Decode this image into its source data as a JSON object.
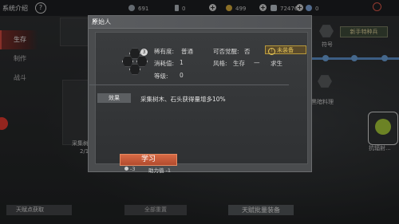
{
  "topbar": {
    "title": "系统介绍",
    "help": "?",
    "resources": [
      {
        "name": "resource-a",
        "value": "691",
        "color": "#9aa3ac"
      },
      {
        "name": "resource-b",
        "value": "0",
        "color": "#b0b6bc"
      },
      {
        "name": "coin",
        "value": "499",
        "color": "#d4a93b"
      },
      {
        "name": "resource-d",
        "value": "72476",
        "color": "#b8c0c8"
      },
      {
        "name": "resource-e",
        "value": "0",
        "color": "#7ea4d8"
      }
    ]
  },
  "sidebar": {
    "items": [
      {
        "label": "生存",
        "active": true
      },
      {
        "label": "制作",
        "active": false
      },
      {
        "label": "战斗",
        "active": false
      }
    ]
  },
  "background": {
    "trait_button": "新手特种兵",
    "slot_label": "符号",
    "card_label_mid": "黑暗料理",
    "card_label_right": "抗辐射...",
    "card_label_left": "采集树木...",
    "card_count": "2/1"
  },
  "bottombar": {
    "left": "天赋点获取",
    "mid": "全部重置",
    "right": "天赋批量装备"
  },
  "dialog": {
    "title": "原始人",
    "close": "✕",
    "skill_badge": "3",
    "rarity_label": "稀有度:",
    "rarity_value": "普通",
    "awaken_label": "可否觉醒:",
    "awaken_value": "否",
    "cost_label": "消耗值:",
    "cost_value": "1",
    "style_label": "风格:",
    "style_value_1": "生存",
    "style_dash": "—",
    "style_value_2": "求生",
    "level_label": "等级:",
    "level_value": "0",
    "status_badge": "未装备",
    "status_icon": "!",
    "effect_label": "效果",
    "effect_text": "采集树木、石头获得量增多10%",
    "learn_button": "学习",
    "cost_points": "-3",
    "ability_cost": "助力值 -1"
  }
}
